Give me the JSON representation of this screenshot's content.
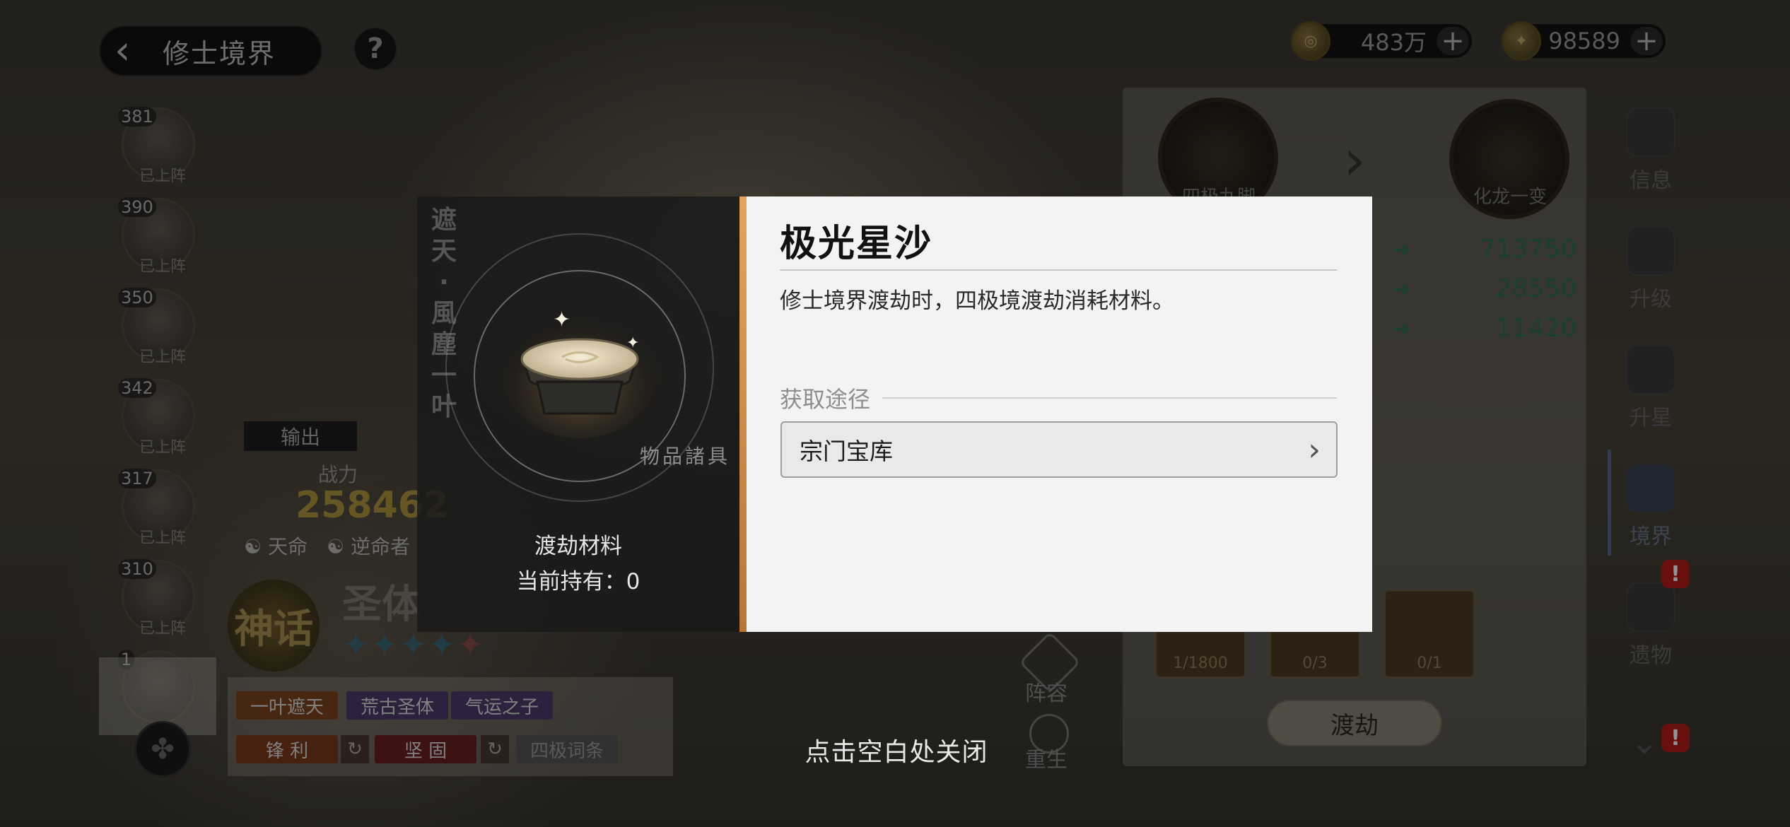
{
  "header": {
    "back_label": "修士境界",
    "help": "?"
  },
  "currencies": [
    {
      "value": "483万",
      "icon": "coin-icon"
    },
    {
      "value": "98589",
      "icon": "spirit-stone-icon"
    }
  ],
  "heroes": [
    {
      "level": "381",
      "status": "已上阵"
    },
    {
      "level": "390",
      "status": "已上阵"
    },
    {
      "level": "350",
      "status": "已上阵"
    },
    {
      "level": "342",
      "status": "已上阵"
    },
    {
      "level": "317",
      "status": "已上阵"
    },
    {
      "level": "310",
      "status": "已上阵"
    },
    {
      "level": "1",
      "status": ""
    }
  ],
  "character": {
    "role": "输出",
    "power_label": "战力",
    "power": "258462",
    "fate": "天命",
    "fate2": "逆命者",
    "name": "圣体",
    "rarity": "神话",
    "tags": [
      "一叶遮天",
      "荒古圣体",
      "气运之子"
    ],
    "traits": [
      "锋 利",
      "坚 固",
      "四极词条"
    ]
  },
  "right_panel": {
    "from": "四极九脚",
    "to": "化龙一变",
    "stats": [
      "713750",
      "28550",
      "11420"
    ],
    "slots": [
      "1/1800",
      "0/3",
      "0/1"
    ],
    "action": "渡劫"
  },
  "side_menu": [
    {
      "label": "信息"
    },
    {
      "label": "升级"
    },
    {
      "label": "升星"
    },
    {
      "label": "境界"
    },
    {
      "label": "遗物"
    }
  ],
  "badge": "!",
  "float_buttons": {
    "lineup": "阵容",
    "rebirth": "重生"
  },
  "modal": {
    "title": "极光星沙",
    "description": "修士境界渡劫时，四极境渡劫消耗材料。",
    "source_header": "获取途径",
    "sources": [
      {
        "label": "宗门宝库"
      }
    ],
    "category": "渡劫材料",
    "count": "当前持有：0",
    "watermark": "物品諸具",
    "vertical_text": "遮天·風塵一叶"
  },
  "close_hint": "点击空白处关闭",
  "colors": {
    "accent": "#d99a4e",
    "panel": "#f3f3f3",
    "badge": "#b31c1c"
  }
}
